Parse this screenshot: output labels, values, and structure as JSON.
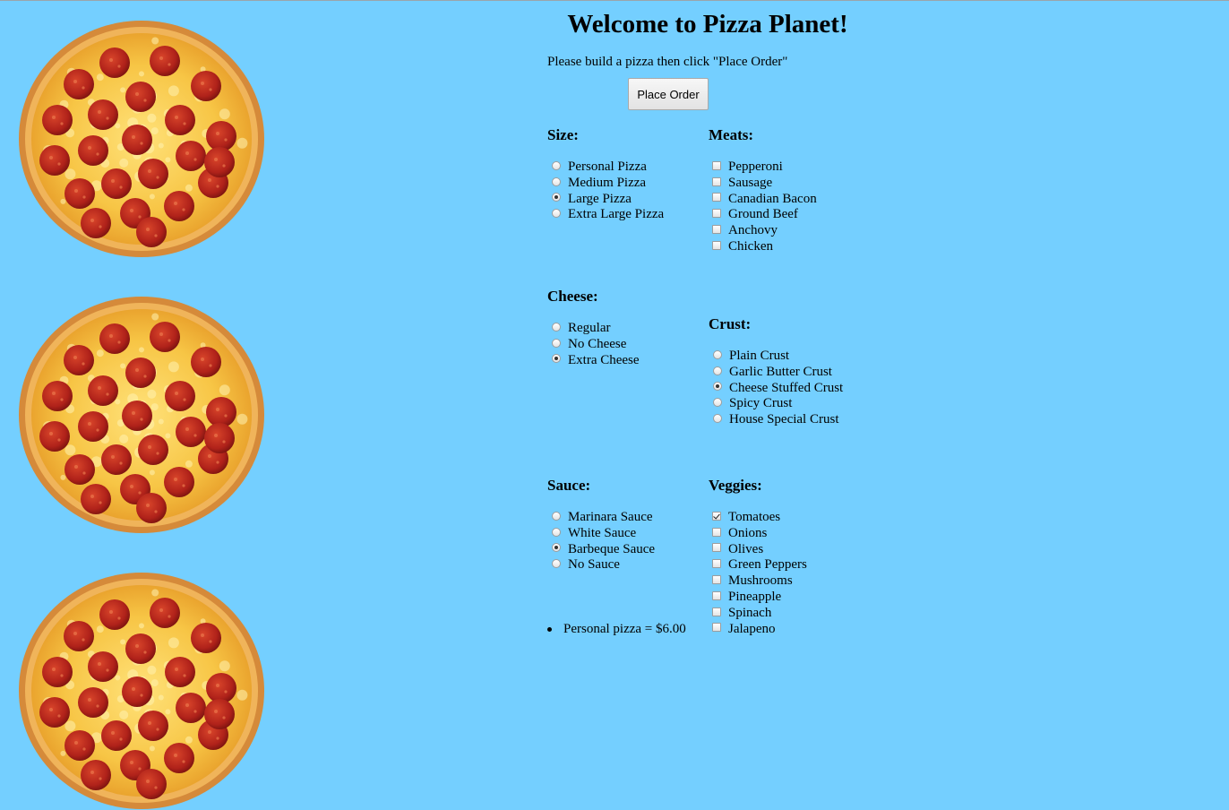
{
  "page": {
    "title": "Welcome to Pizza Planet!",
    "instructions": "Please build a pizza then click \"Place Order\"",
    "order_button": "Place Order"
  },
  "images": [
    {
      "name": "pepperoni-pizza-image"
    },
    {
      "name": "pepperoni-pizza-image"
    },
    {
      "name": "pepperoni-pizza-image"
    }
  ],
  "size": {
    "heading": "Size:",
    "options": [
      {
        "label": "Personal Pizza",
        "selected": false
      },
      {
        "label": "Medium Pizza",
        "selected": false
      },
      {
        "label": "Large Pizza",
        "selected": true
      },
      {
        "label": "Extra Large Pizza",
        "selected": false
      }
    ]
  },
  "meats": {
    "heading": "Meats:",
    "options": [
      {
        "label": "Pepperoni",
        "checked": false
      },
      {
        "label": "Sausage",
        "checked": false
      },
      {
        "label": "Canadian Bacon",
        "checked": false
      },
      {
        "label": "Ground Beef",
        "checked": false
      },
      {
        "label": "Anchovy",
        "checked": false
      },
      {
        "label": "Chicken",
        "checked": false
      }
    ]
  },
  "cheese": {
    "heading": "Cheese:",
    "options": [
      {
        "label": "Regular",
        "selected": false
      },
      {
        "label": "No Cheese",
        "selected": false
      },
      {
        "label": "Extra Cheese",
        "selected": true
      }
    ]
  },
  "crust": {
    "heading": "Crust:",
    "options": [
      {
        "label": "Plain Crust",
        "selected": false
      },
      {
        "label": "Garlic Butter Crust",
        "selected": false
      },
      {
        "label": "Cheese Stuffed Crust",
        "selected": true
      },
      {
        "label": "Spicy Crust",
        "selected": false
      },
      {
        "label": "House Special Crust",
        "selected": false
      }
    ]
  },
  "sauce": {
    "heading": "Sauce:",
    "options": [
      {
        "label": "Marinara Sauce",
        "selected": false
      },
      {
        "label": "White Sauce",
        "selected": false
      },
      {
        "label": "Barbeque Sauce",
        "selected": true
      },
      {
        "label": "No Sauce",
        "selected": false
      }
    ]
  },
  "veggies": {
    "heading": "Veggies:",
    "options": [
      {
        "label": "Tomatoes",
        "checked": true
      },
      {
        "label": "Onions",
        "checked": false
      },
      {
        "label": "Olives",
        "checked": false
      },
      {
        "label": "Green Peppers",
        "checked": false
      },
      {
        "label": "Mushrooms",
        "checked": false
      },
      {
        "label": "Pineapple",
        "checked": false
      },
      {
        "label": "Spinach",
        "checked": false
      },
      {
        "label": "Jalapeno",
        "checked": false
      }
    ]
  },
  "summary": {
    "items": [
      "Personal pizza = $6.00"
    ]
  },
  "colors": {
    "background": "#74cfff"
  }
}
